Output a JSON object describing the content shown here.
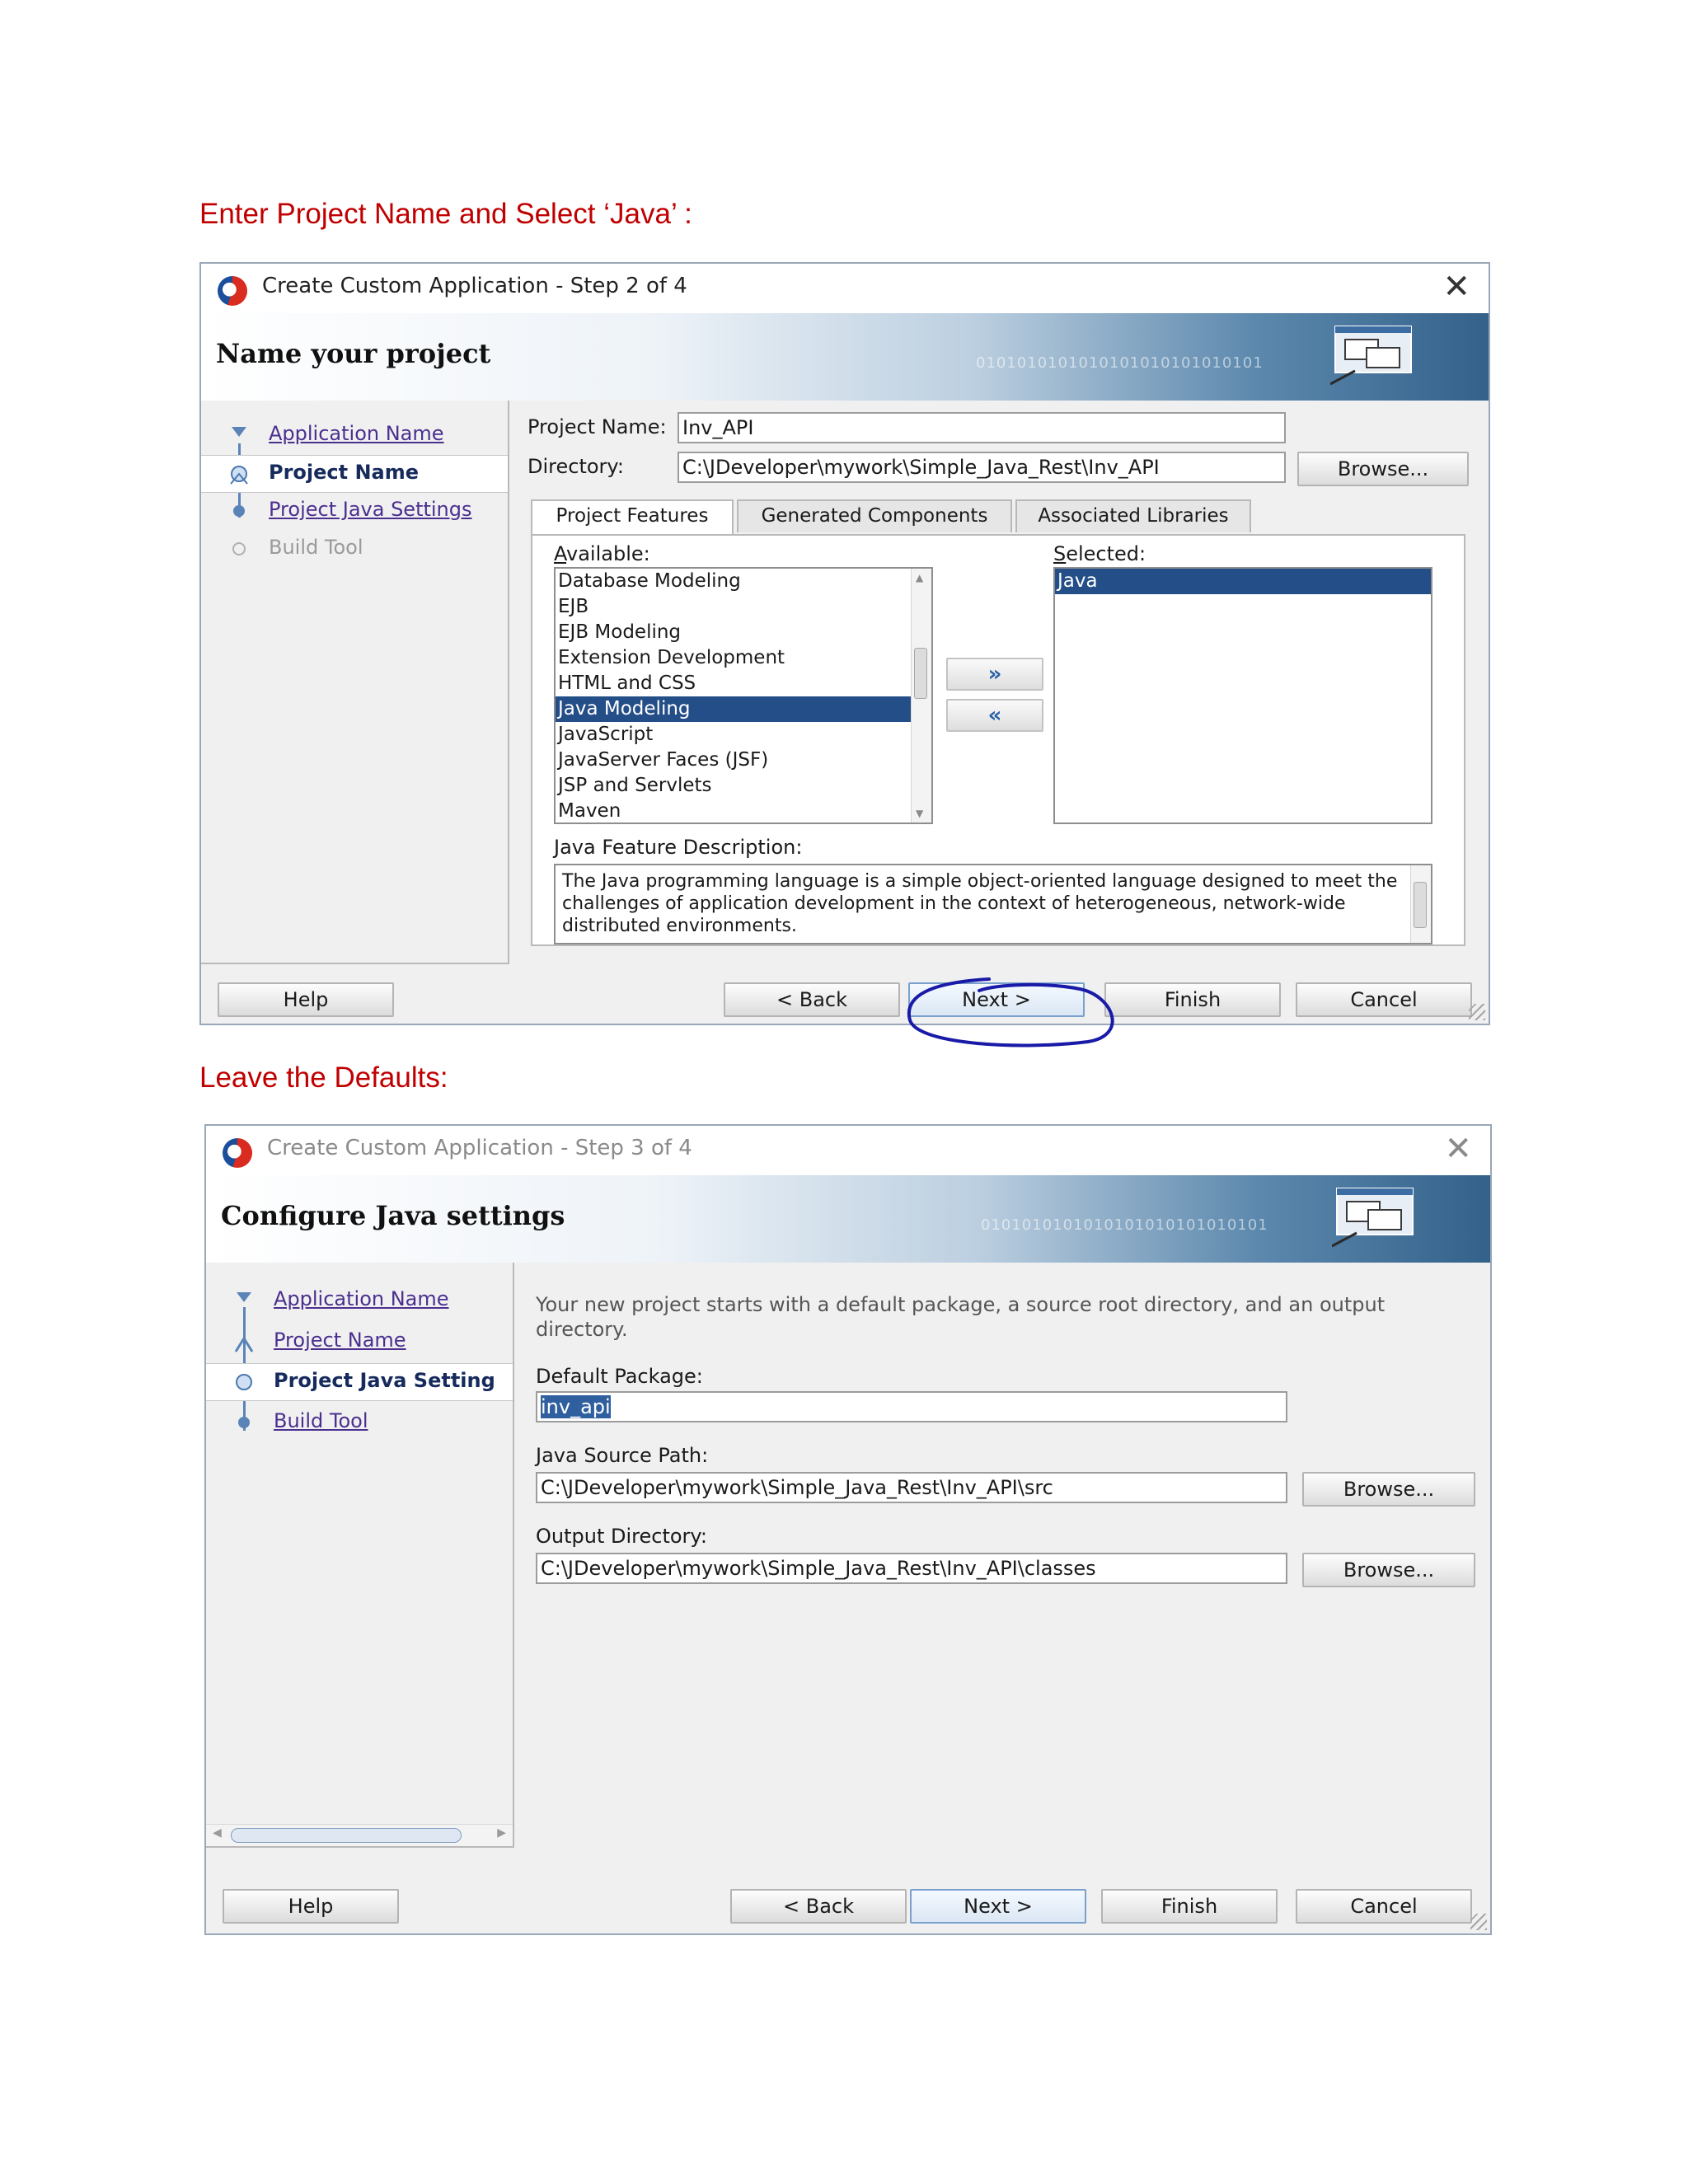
{
  "captions": {
    "first": "Enter Project Name and Select ‘Java’ :",
    "second": "Leave the Defaults:"
  },
  "dialog1": {
    "title": "Create Custom Application - Step 2 of 4",
    "banner_title": "Name your project",
    "banner_binary": "0101010101010101010101010101",
    "nav": [
      {
        "label": "Application Name",
        "state": "link"
      },
      {
        "label": "Project Name",
        "state": "current"
      },
      {
        "label": "Project Java Settings",
        "state": "link"
      },
      {
        "label": "Build Tool",
        "state": "disabled"
      }
    ],
    "project_name_label": "Project Name:",
    "project_name_value": "Inv_API",
    "directory_label": "Directory:",
    "directory_value": "C:\\JDeveloper\\mywork\\Simple_Java_Rest\\Inv_API",
    "browse_label": "Browse...",
    "tabs": [
      "Project Features",
      "Generated Components",
      "Associated Libraries"
    ],
    "available_label": "Available:",
    "available_items": [
      "Database Modeling",
      "EJB",
      "EJB Modeling",
      "Extension Development",
      "HTML and CSS",
      "Java Modeling",
      "JavaScript",
      "JavaServer Faces (JSF)",
      "JSP and Servlets",
      "Maven"
    ],
    "available_selected": "Java Modeling",
    "selected_label": "Selected:",
    "selected_items": [
      "Java"
    ],
    "add_glyph": "»",
    "remove_glyph": "«",
    "description_label": "Java Feature Description:",
    "description_text": "The Java programming language is a simple object-oriented language designed to meet the challenges of application development in the context of heterogeneous, network-wide distributed environments.",
    "buttons": {
      "help": "Help",
      "back": "< Back",
      "next": "Next >",
      "finish": "Finish",
      "cancel": "Cancel"
    },
    "annotation_color": "#1a1aa8"
  },
  "dialog2": {
    "title": "Create Custom Application - Step 3 of 4",
    "banner_title": "Configure Java settings",
    "banner_binary": "0101010101010101010101010101",
    "nav": [
      {
        "label": "Application Name",
        "state": "link"
      },
      {
        "label": "Project Name",
        "state": "link"
      },
      {
        "label": "Project Java Setting",
        "state": "current"
      },
      {
        "label": "Build Tool",
        "state": "link"
      }
    ],
    "intro_text": "Your new project starts with a default package, a source root directory, and an output directory.",
    "default_package_label": "Default Package:",
    "default_package_value": "inv_api",
    "source_path_label": "Java Source Path:",
    "source_path_value": "C:\\JDeveloper\\mywork\\Simple_Java_Rest\\Inv_API\\src",
    "output_dir_label": "Output Directory:",
    "output_dir_value": "C:\\JDeveloper\\mywork\\Simple_Java_Rest\\Inv_API\\classes",
    "browse_label": "Browse...",
    "buttons": {
      "help": "Help",
      "back": "< Back",
      "next": "Next >",
      "finish": "Finish",
      "cancel": "Cancel"
    }
  }
}
